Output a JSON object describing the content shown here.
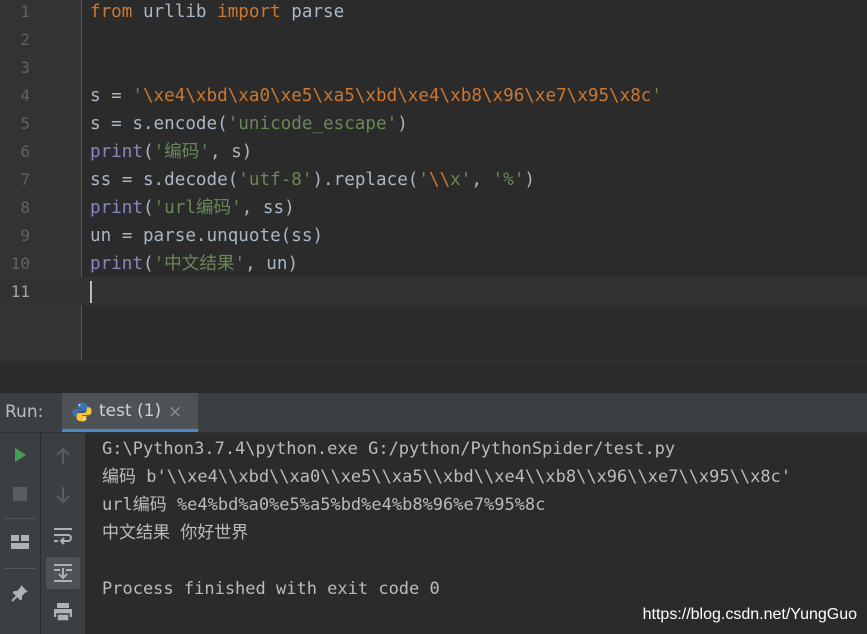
{
  "editor": {
    "line_numbers": [
      "1",
      "2",
      "3",
      "4",
      "5",
      "6",
      "7",
      "8",
      "9",
      "10",
      "11"
    ],
    "code": {
      "l1_from": "from",
      "l1_mod": " urllib ",
      "l1_import": "import",
      "l1_name": " parse",
      "l4_lhs": "s = ",
      "l4_q": "'",
      "l4_esc": "\\xe4\\xbd\\xa0\\xe5\\xa5\\xbd\\xe4\\xb8\\x96\\xe7\\x95\\x8c",
      "l4_q2": "'",
      "l5_pre": "s = s.encode(",
      "l5_str": "'unicode_escape'",
      "l5_post": ")",
      "l6_fn": "print",
      "l6_open": "(",
      "l6_str": "'编码'",
      "l6_post": ", s)",
      "l7_pre": "ss = s.decode(",
      "l7_str1": "'utf-8'",
      "l7_mid": ").replace(",
      "l7_q": "'",
      "l7_esc": "\\\\",
      "l7_x": "x'",
      "l7_comma": ", ",
      "l7_str2": "'%'",
      "l7_post": ")",
      "l8_fn": "print",
      "l8_open": "(",
      "l8_str": "'url编码'",
      "l8_post": ", ss)",
      "l9": "un = parse.unquote(ss)",
      "l10_fn": "print",
      "l10_open": "(",
      "l10_str": "'中文结果'",
      "l10_post": ", un)"
    }
  },
  "run": {
    "label": "Run:",
    "tab_label": "test (1)",
    "tab_close": "×",
    "icons": [
      "run-icon",
      "stop-icon",
      "up-arrow-icon",
      "down-arrow-icon",
      "layout-icon",
      "soft-wrap-icon",
      "pin-icon",
      "scroll-to-end-icon",
      "print-icon",
      "python-icon",
      "close-icon"
    ],
    "output": [
      "G:\\Python3.7.4\\python.exe G:/python/PythonSpider/test.py",
      "编码 b'\\\\xe4\\\\xbd\\\\xa0\\\\xe5\\\\xa5\\\\xbd\\\\xe4\\\\xb8\\\\x96\\\\xe7\\\\x95\\\\x8c'",
      "url编码 %e4%bd%a0%e5%a5%bd%e4%b8%96%e7%95%8c",
      "中文结果 你好世界",
      "Process finished with exit code 0"
    ]
  },
  "watermark": "https://blog.csdn.net/YungGuo",
  "colors": {
    "keyword": "#cc7832",
    "string": "#6a8759",
    "builtin": "#8888c6",
    "text": "#a9b7c6",
    "run_green": "#499c54",
    "tab_underline": "#4a88c7"
  }
}
